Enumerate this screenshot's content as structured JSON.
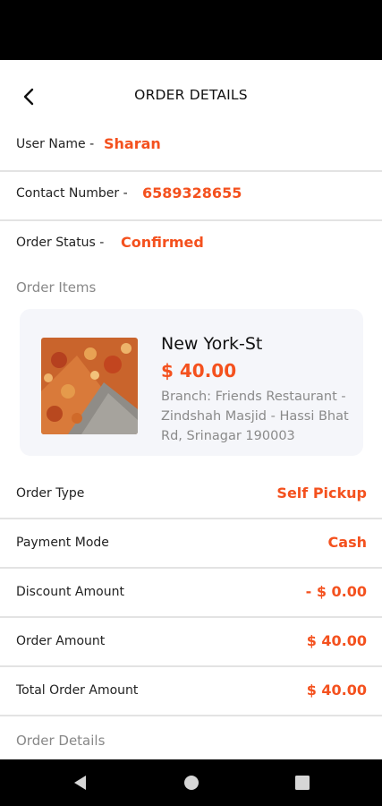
{
  "header": {
    "title": "ORDER DETAILS"
  },
  "user": {
    "name_label": "User Name -",
    "name_value": "Sharan",
    "contact_label": "Contact Number -",
    "contact_value": "6589328655",
    "status_label": "Order Status -",
    "status_value": "Confirmed"
  },
  "order_items_label": "Order Items",
  "item": {
    "name": "New York-St",
    "price": "$ 40.00",
    "branch": "Branch: Friends Restaurant - Zindshah Masjid - Hassi Bhat Rd, Srinagar 190003"
  },
  "summary": [
    {
      "label": "Order Type",
      "value": "Self Pickup"
    },
    {
      "label": "Payment Mode",
      "value": "Cash"
    },
    {
      "label": "Discount Amount",
      "value": "- $ 0.00"
    },
    {
      "label": "Order Amount",
      "value": "$ 40.00"
    },
    {
      "label": "Total Order Amount",
      "value": "$ 40.00"
    }
  ],
  "order_details_label": "Order Details",
  "colors": {
    "accent": "#f4511e",
    "card": "#f5f6fa",
    "divider": "#e3e3e3"
  },
  "icons": {
    "back": "arrow-left",
    "nav_back": "triangle-left",
    "nav_home": "circle",
    "nav_recents": "square"
  }
}
